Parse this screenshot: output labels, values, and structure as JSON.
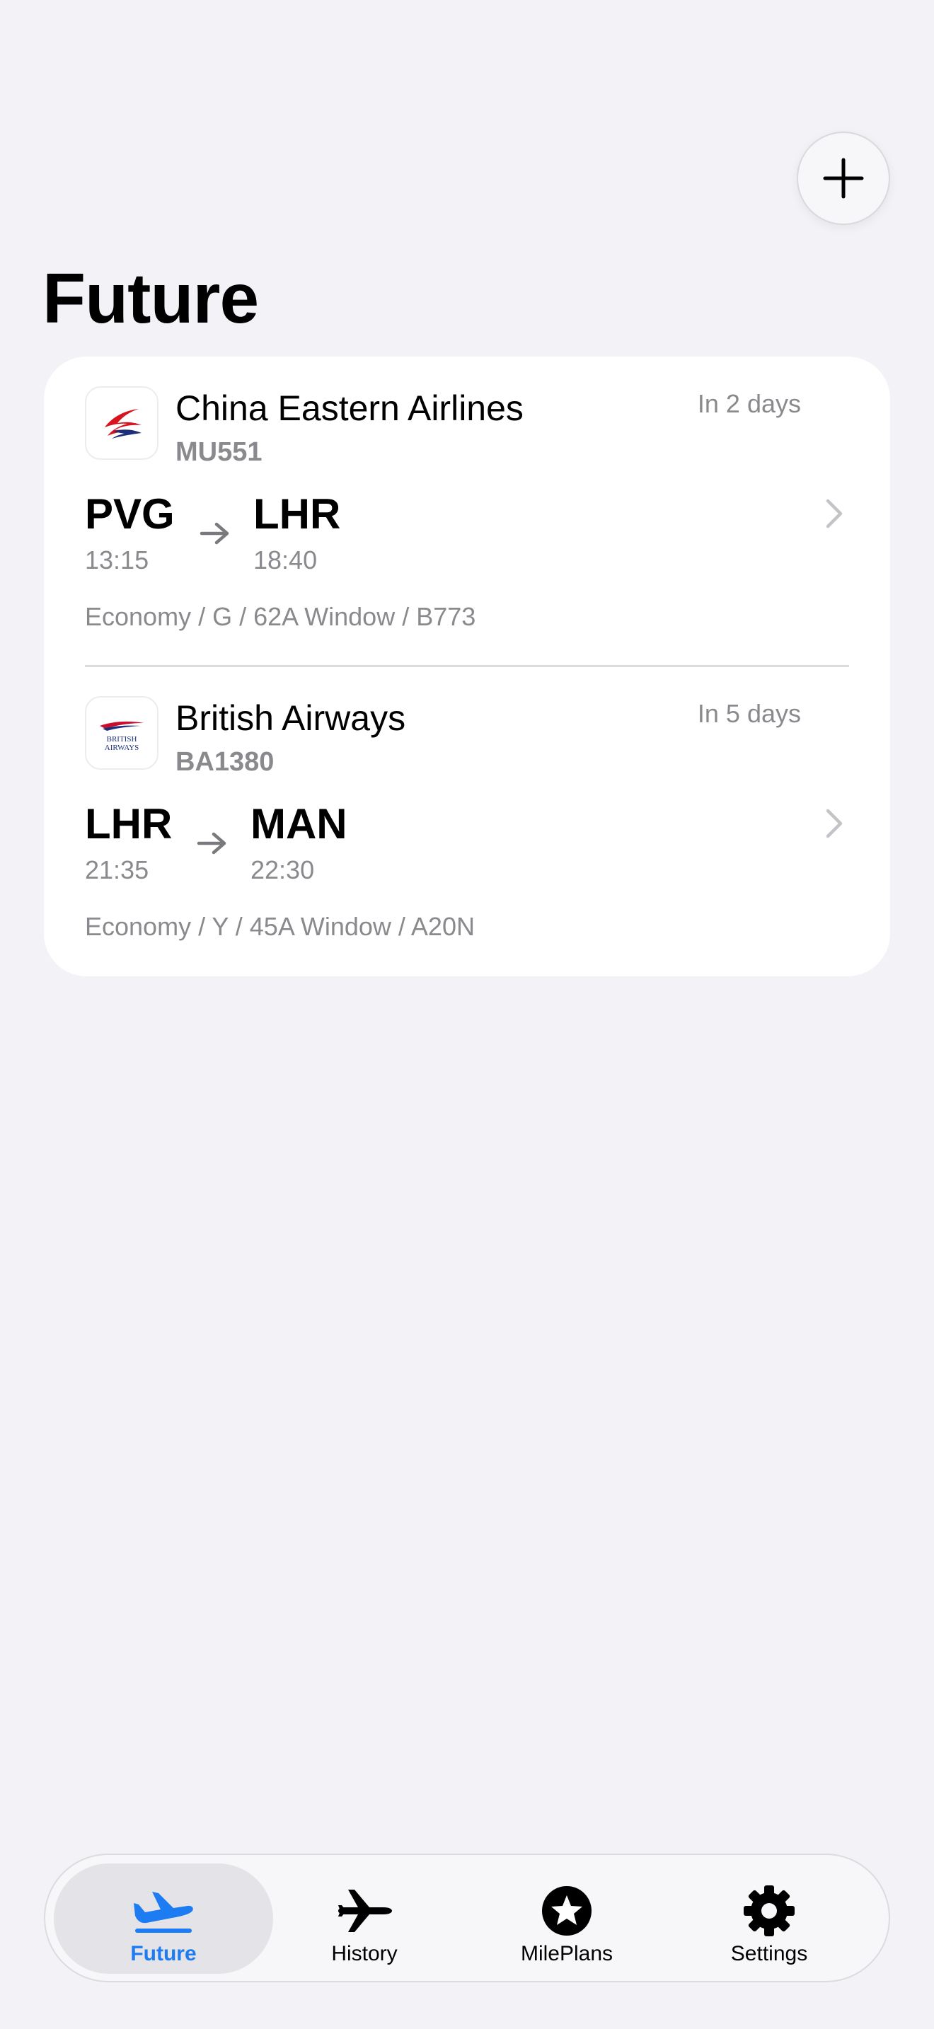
{
  "header": {
    "title": "Future",
    "add_button_icon": "plus-icon"
  },
  "flights": [
    {
      "airline": "China Eastern Airlines",
      "code": "MU551",
      "relative_date": "In 2 days",
      "origin": "PVG",
      "origin_time": "13:15",
      "destination": "LHR",
      "destination_time": "18:40",
      "details": "Economy / G / 62A Window / B773",
      "logo_icon": "china-eastern-logo"
    },
    {
      "airline": "British Airways",
      "code": "BA1380",
      "relative_date": "In 5 days",
      "origin": "LHR",
      "origin_time": "21:35",
      "destination": "MAN",
      "destination_time": "22:30",
      "details": "Economy / Y / 45A Window / A20N",
      "logo_icon": "british-airways-logo",
      "logo_text": [
        "BRITISH",
        "AIRWAYS"
      ]
    }
  ],
  "tabbar": {
    "tabs": [
      {
        "label": "Future",
        "icon": "plane-departure-icon",
        "active": true
      },
      {
        "label": "History",
        "icon": "plane-icon",
        "active": false
      },
      {
        "label": "MilePlans",
        "icon": "star-circle-icon",
        "active": false
      },
      {
        "label": "Settings",
        "icon": "gear-icon",
        "active": false
      }
    ]
  },
  "colors": {
    "background": "#f2f2f7",
    "card": "#ffffff",
    "accent": "#1e7cf2",
    "secondary_text": "#8a8a8e"
  }
}
